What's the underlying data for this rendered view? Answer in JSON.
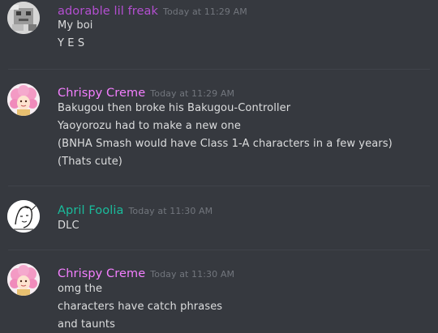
{
  "colors": {
    "background": "#36393f",
    "username_purple": "#b44fd1",
    "username_pink": "#f47fff",
    "username_green": "#1abc9c",
    "message_text": "#dcddde",
    "timestamp": "#72767d"
  },
  "messages": [
    {
      "avatar_icon": "pixel-character-avatar-icon",
      "username": "adorable lil freak",
      "timestamp": "Today at 11:29 AM",
      "lines": [
        "My boi",
        "Y E S"
      ]
    },
    {
      "avatar_icon": "pink-hair-avatar-icon",
      "username": "Chrispy Creme",
      "timestamp": "Today at 11:29 AM",
      "lines": [
        "Bakugou then broke his Bakugou-Controller",
        "Yaoyorozu had to make a new one",
        "(BNHA Smash would have Class 1-A characters in a few years)",
        "(Thats cute)"
      ]
    },
    {
      "avatar_icon": "sketch-character-avatar-icon",
      "username": "April Foolia",
      "timestamp": "Today at 11:30 AM",
      "lines": [
        "DLC"
      ]
    },
    {
      "avatar_icon": "pink-hair-avatar-icon",
      "username": "Chrispy Creme",
      "timestamp": "Today at 11:30 AM",
      "lines": [
        "omg the",
        "characters have catch phrases",
        "and taunts"
      ]
    }
  ]
}
